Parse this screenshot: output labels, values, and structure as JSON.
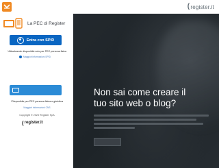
{
  "header": {
    "logo_text": "register.it"
  },
  "panel": {
    "title": "La PEC di Register",
    "spid_button_label": "Entra con SPID",
    "spid_note": "*Attualmente disponibile solo per PEC persona fisica",
    "spid_help": "Maggiori informazioni SPID",
    "cns_note": "*Disponibile per PEC persona fisica e giuridica",
    "cns_help": "Maggiori informazioni CNS",
    "copyright": "Copyright © 2023 Register SpA",
    "footer_logo": "register.it"
  },
  "hero": {
    "title_line1": "Non sai come creare il",
    "title_line2": "tuo sito web o blog?"
  },
  "colors": {
    "accent": "#f08a24",
    "spid_blue": "#0a66c2",
    "cns_blue": "#2b8bd6",
    "hero_bg": "#1e2428"
  }
}
